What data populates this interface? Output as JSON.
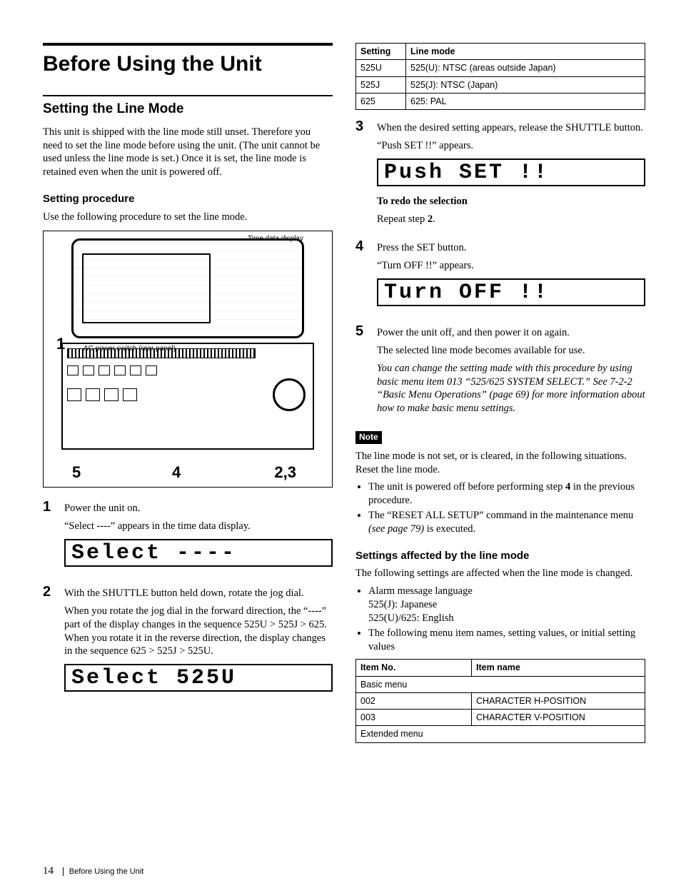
{
  "header": {
    "chapter_title": "Before Using the Unit",
    "section_title": "Setting the Line Mode",
    "intro": "This unit is shipped with the line mode still unset. Therefore you need to set the line mode before using the unit. (The unit cannot be used unless the line mode is set.) Once it is set, the line mode is retained even when the unit is powered off.",
    "sub_procedure": "Setting procedure",
    "procedure_lead": "Use the following procedure to set the line mode."
  },
  "figure": {
    "time_display_label": "Time data display",
    "ac_switch_label": "AC power switch (rear panel)",
    "callout_1": "1",
    "callout_5": "5",
    "callout_4": "4",
    "callout_23": "2,3"
  },
  "steps": {
    "s1_num": "1",
    "s1_a": "Power the unit on.",
    "s1_b": "“Select ----” appears in the time data display.",
    "lcd1": "Select ----",
    "s2_num": "2",
    "s2_a": "With the SHUTTLE button held down, rotate the jog dial.",
    "s2_b": "When you rotate the jog dial in the forward direction, the “----” part of the display changes in the sequence 525U > 525J > 625. When you rotate it in the reverse direction, the display changes in the sequence 625 > 525J > 525U.",
    "lcd2": "Select 525U",
    "s3_num": "3",
    "s3_a": "When the desired setting appears, release the SHUTTLE button.",
    "s3_b": "“Push SET !!” appears.",
    "lcd3": "Push SET !!",
    "redo_head": "To redo the selection",
    "redo_body": "Repeat step 2.",
    "s4_num": "4",
    "s4_a": "Press the SET button.",
    "s4_b": "“Turn OFF !!” appears.",
    "lcd4": "Turn OFF !!",
    "s5_num": "5",
    "s5_a": "Power the unit off, and then power it on again.",
    "s5_b": "The selected line mode becomes available for use.",
    "s5_note": "You can change the setting made with this procedure by using basic menu item 013 “525/625 SYSTEM SELECT.” See 7-2-2 “Basic Menu Operations” (page 69) for more information about how to make basic menu settings."
  },
  "table1": {
    "h1": "Setting",
    "h2": "Line mode",
    "r1c1": "525U",
    "r1c2": "525(U): NTSC (areas outside Japan)",
    "r2c1": "525J",
    "r2c2": "525(J): NTSC (Japan)",
    "r3c1": "625",
    "r3c2": "625: PAL"
  },
  "note": {
    "badge": "Note",
    "lead": "The line mode is not set, or is cleared, in the following situations. Reset the line mode.",
    "b1": "The unit is powered off before performing step 4 in the previous procedure.",
    "b2a": "The “RESET ALL SETUP” command in the maintenance menu ",
    "b2b": "(see page 79)",
    "b2c": " is executed."
  },
  "affected": {
    "heading": "Settings affected by the line mode",
    "lead": "The following settings are affected when the line mode is changed.",
    "b1a": "Alarm message language",
    "b1b": "525(J): Japanese",
    "b1c": "525(U)/625: English",
    "b2": "The following menu item names, setting values, or initial setting values"
  },
  "table2": {
    "h1": "Item No.",
    "h2": "Item name",
    "r1": "Basic menu",
    "r2c1": "002",
    "r2c2": "CHARACTER H-POSITION",
    "r3c1": "003",
    "r3c2": "CHARACTER V-POSITION",
    "r4": "Extended menu"
  },
  "footer": {
    "page": "14",
    "chapter": "Before Using the Unit"
  }
}
